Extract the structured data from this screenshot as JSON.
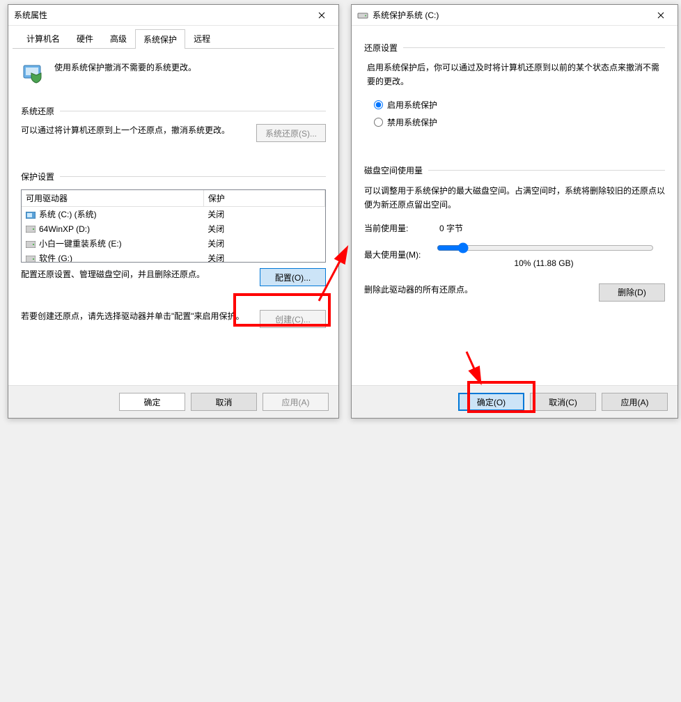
{
  "left": {
    "title": "系统属性",
    "tabs": [
      "计算机名",
      "硬件",
      "高级",
      "系统保护",
      "远程"
    ],
    "active_tab": 3,
    "intro": "使用系统保护撤消不需要的系统更改。",
    "restore": {
      "heading": "系统还原",
      "desc": "可以通过将计算机还原到上一个还原点，撤消系统更改。",
      "button": "系统还原(S)..."
    },
    "protect": {
      "heading": "保护设置",
      "col_drive": "可用驱动器",
      "col_state": "保护",
      "rows": [
        {
          "icon": "sys",
          "name": "系统 (C:) (系统)",
          "state": "关闭"
        },
        {
          "icon": "hdd",
          "name": "64WinXP  (D:)",
          "state": "关闭"
        },
        {
          "icon": "hdd",
          "name": "小白一键重装系统 (E:)",
          "state": "关闭"
        },
        {
          "icon": "hdd",
          "name": "软件 (G:)",
          "state": "关闭"
        }
      ],
      "config_desc": "配置还原设置、管理磁盘空间，并且删除还原点。",
      "config_btn": "配置(O)...",
      "create_desc": "若要创建还原点，请先选择驱动器并单击\"配置\"来启用保护。",
      "create_btn": "创建(C)..."
    },
    "buttons": {
      "ok": "确定",
      "cancel": "取消",
      "apply": "应用(A)"
    }
  },
  "right": {
    "title": "系统保护系统 (C:)",
    "restore": {
      "heading": "还原设置",
      "desc": "启用系统保护后，你可以通过及时将计算机还原到以前的某个状态点来撤消不需要的更改。",
      "opt_enable": "启用系统保护",
      "opt_disable": "禁用系统保护"
    },
    "disk": {
      "heading": "磁盘空间使用量",
      "desc": "可以调整用于系统保护的最大磁盘空间。占满空间时，系统将删除较旧的还原点以便为新还原点留出空间。",
      "current_k": "当前使用量:",
      "current_v": "0 字节",
      "max_k": "最大使用量(M):",
      "slider_text": "10% (11.88 GB)",
      "delete_desc": "删除此驱动器的所有还原点。",
      "delete_btn": "删除(D)"
    },
    "buttons": {
      "ok": "确定(O)",
      "cancel": "取消(C)",
      "apply": "应用(A)"
    }
  }
}
